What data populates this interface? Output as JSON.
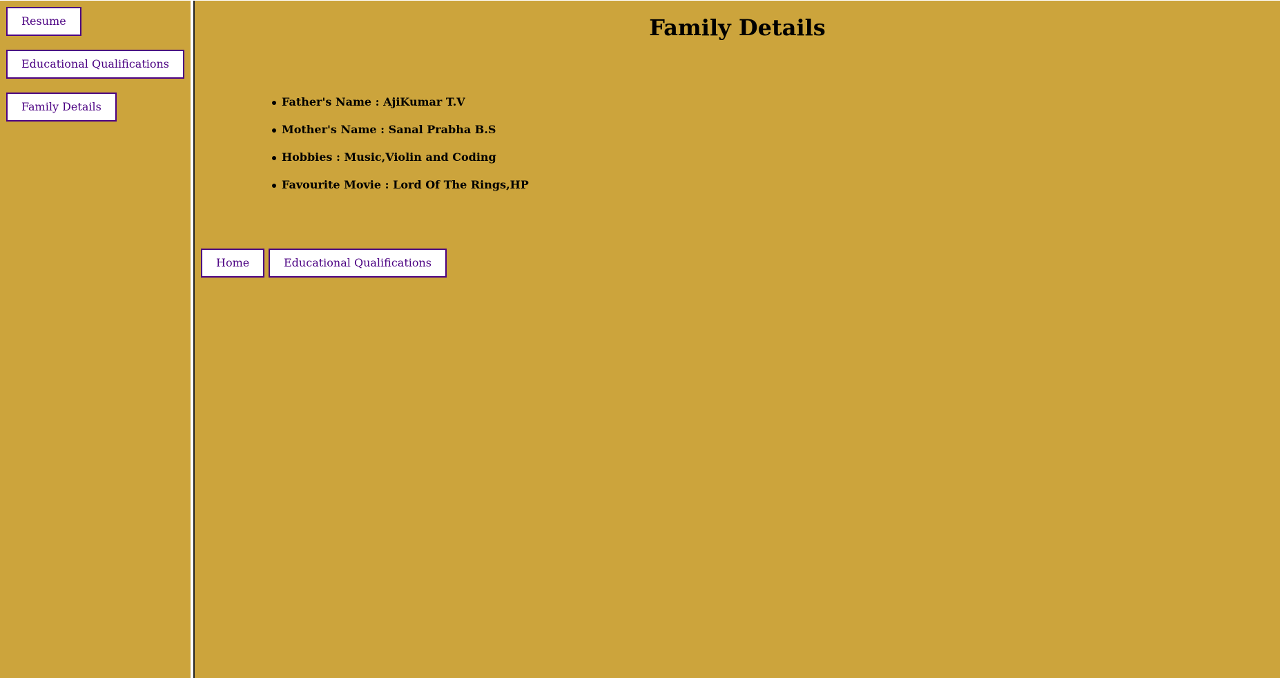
{
  "sidebar": {
    "buttons": [
      {
        "label": "Resume"
      },
      {
        "label": "Educational Qualifications"
      },
      {
        "label": "Family Details"
      }
    ]
  },
  "main": {
    "title": "Family Details",
    "details": [
      {
        "label": "Father's Name : AjiKumar T.V"
      },
      {
        "label": "Mother's Name : Sanal Prabha B.S"
      },
      {
        "label": "Hobbies : Music,Violin and Coding"
      },
      {
        "label": "Favourite Movie : Lord Of The Rings,HP"
      }
    ],
    "nav": [
      {
        "label": "Home"
      },
      {
        "label": "Educational Qualifications"
      }
    ]
  },
  "colors": {
    "background": "#CCA43C",
    "button_border": "#4B0082",
    "button_text": "#4B0082",
    "button_bg": "#FFFFFF"
  }
}
